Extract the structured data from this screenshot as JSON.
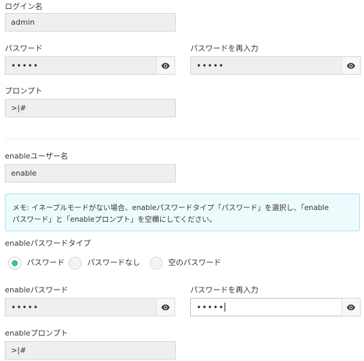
{
  "login": {
    "label": "ログイン名",
    "value": "admin"
  },
  "password": {
    "label": "パスワード",
    "value": "•••••",
    "toggle_icon": "eye-icon"
  },
  "password_confirm": {
    "label": "パスワードを再入力",
    "value": "•••••",
    "toggle_icon": "eye-icon"
  },
  "prompt": {
    "label": "プロンプト",
    "value": ">|#"
  },
  "enable_user": {
    "label": "enableユーザー名",
    "value": "enable"
  },
  "notice": {
    "line1": "メモ: イネーブルモードがない場合、enableパスワードタイプ「パスワード」を選択し、「enable",
    "line2": "パスワード」と「enableプロンプト」を空欄にしてください。",
    "colors": {
      "background": "#eefbfd",
      "border": "#a5e3ef"
    }
  },
  "enable_password_type": {
    "label": "enableパスワードタイプ",
    "options": [
      {
        "label": "パスワード",
        "selected": true
      },
      {
        "label": "パスワードなし",
        "selected": false
      },
      {
        "label": "空のパスワード",
        "selected": false
      }
    ],
    "accent_color": "#3cc285"
  },
  "enable_password": {
    "label": "enableパスワード",
    "value": "•••••",
    "toggle_icon": "eye-icon"
  },
  "enable_password_confirm": {
    "label": "パスワードを再入力",
    "value": "•••••",
    "toggle_icon": "eye-icon",
    "focused": true
  },
  "enable_prompt": {
    "label": "enableプロンプト",
    "value": ">|#"
  }
}
